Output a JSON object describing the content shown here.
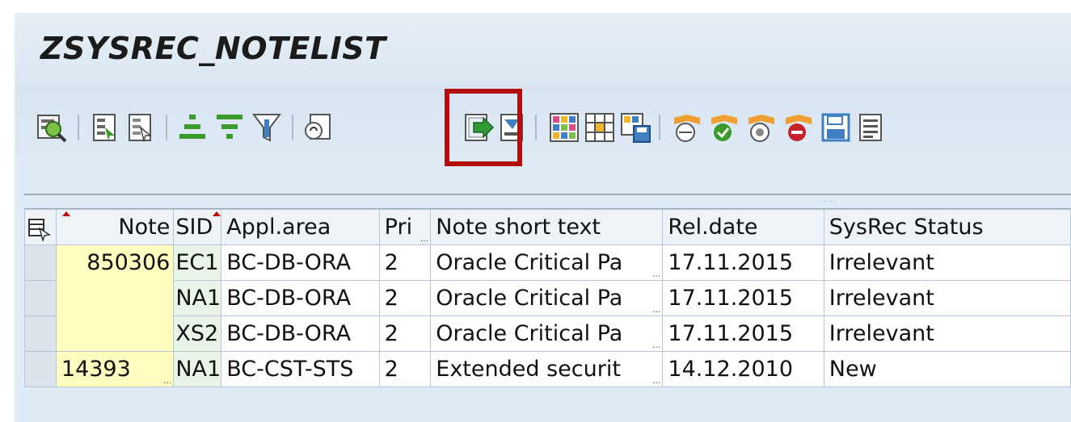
{
  "title": "ZSYSREC_NOTELIST",
  "toolbar": {
    "icons": [
      "details-icon",
      "select-all-icon",
      "deselect-all-icon",
      "sort-ascending-icon",
      "sort-descending-icon",
      "filter-icon",
      "total-icon",
      "export-icon",
      "print-icon",
      "change-layout-icon",
      "select-layout-icon",
      "save-layout-icon",
      "status-reset-icon",
      "status-implemented-icon",
      "status-irrelevant-icon",
      "status-new-icon",
      "save-icon",
      "info-icon"
    ]
  },
  "table": {
    "headers": [
      "Note",
      "SID",
      "Appl.area",
      "Pri",
      "Note short text",
      "Rel.date",
      "SysRec Status"
    ],
    "rows": [
      {
        "note": "850306",
        "sid": "EC1",
        "area": "BC-DB-ORA",
        "pri": "2",
        "text": "Oracle Critical Pa",
        "date": "17.11.2015",
        "status": "Irrelevant"
      },
      {
        "note": "",
        "sid": "NA1",
        "area": "BC-DB-ORA",
        "pri": "2",
        "text": "Oracle Critical Pa",
        "date": "17.11.2015",
        "status": "Irrelevant"
      },
      {
        "note": "",
        "sid": "XS2",
        "area": "BC-DB-ORA",
        "pri": "2",
        "text": "Oracle Critical Pa",
        "date": "17.11.2015",
        "status": "Irrelevant"
      },
      {
        "note": "14393",
        "sid": "NA1",
        "area": "BC-CST-STS",
        "pri": "2",
        "text": "Extended securit",
        "date": "14.12.2010",
        "status": "New"
      }
    ]
  }
}
